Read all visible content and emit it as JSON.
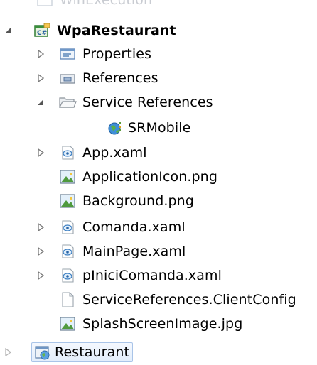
{
  "tree": {
    "ghost_item": "WinExecution",
    "project": "WpaRestaurant",
    "items": [
      {
        "label": "Properties"
      },
      {
        "label": "References"
      },
      {
        "label": "Service References"
      },
      {
        "label": "SRMobile"
      },
      {
        "label": "App.xaml"
      },
      {
        "label": "ApplicationIcon.png"
      },
      {
        "label": "Background.png"
      },
      {
        "label": "Comanda.xaml"
      },
      {
        "label": "MainPage.xaml"
      },
      {
        "label": "pIniciComanda.xaml"
      },
      {
        "label": "ServiceReferences.ClientConfig"
      },
      {
        "label": "SplashScreenImage.jpg"
      }
    ],
    "next_project": "Restaurant"
  }
}
